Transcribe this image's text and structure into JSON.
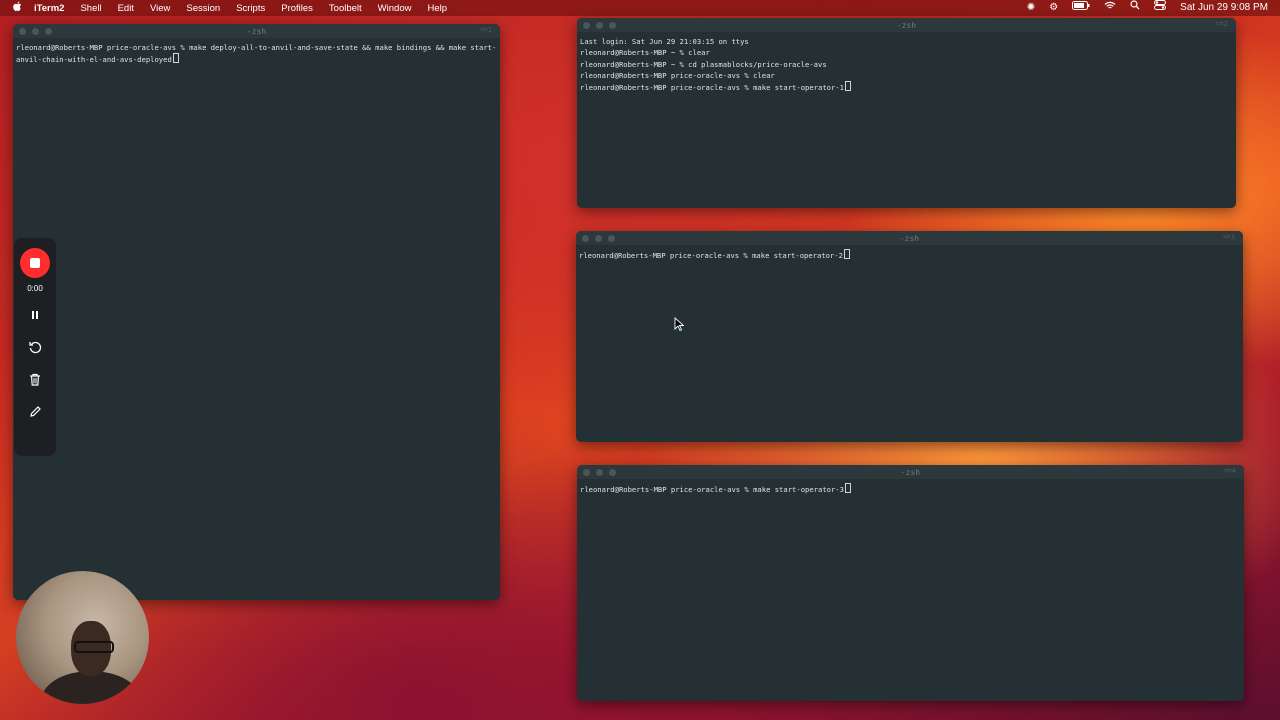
{
  "menubar": {
    "app": "iTerm2",
    "items": [
      "Shell",
      "Edit",
      "View",
      "Session",
      "Scripts",
      "Profiles",
      "Toolbelt",
      "Window",
      "Help"
    ],
    "clock": "Sat Jun 29  9:08 PM"
  },
  "windows": {
    "left": {
      "title": "-zsh",
      "shortcut": "⌥⌘1",
      "line1": "rleonard@Roberts-MBP price-oracle-avs % make deploy-all-to-anvil-and-save-state && make bindings && make start-anvil-chain-with-el-and-avs-deployed"
    },
    "top_right": {
      "title": "-zsh",
      "shortcut": "⌥⌘2",
      "lines": [
        "Last login: Sat Jun 29 21:03:15 on ttys",
        "rleonard@Roberts-MBP ~ % clear",
        "rleonard@Roberts-MBP ~ % cd plasmablocks/price-oracle-avs",
        "rleonard@Roberts-MBP price-oracle-avs % clear",
        "rleonard@Roberts-MBP price-oracle-avs % make start-operator-1"
      ]
    },
    "mid_right": {
      "title": "-zsh",
      "shortcut": "⌥⌘3",
      "line1": "rleonard@Roberts-MBP price-oracle-avs % make start-operator-2"
    },
    "bottom_right": {
      "title": "-zsh",
      "shortcut": "⌥⌘4",
      "line1": "rleonard@Roberts-MBP price-oracle-avs % make start-operator-3"
    }
  },
  "recorder": {
    "time": "0:00"
  }
}
